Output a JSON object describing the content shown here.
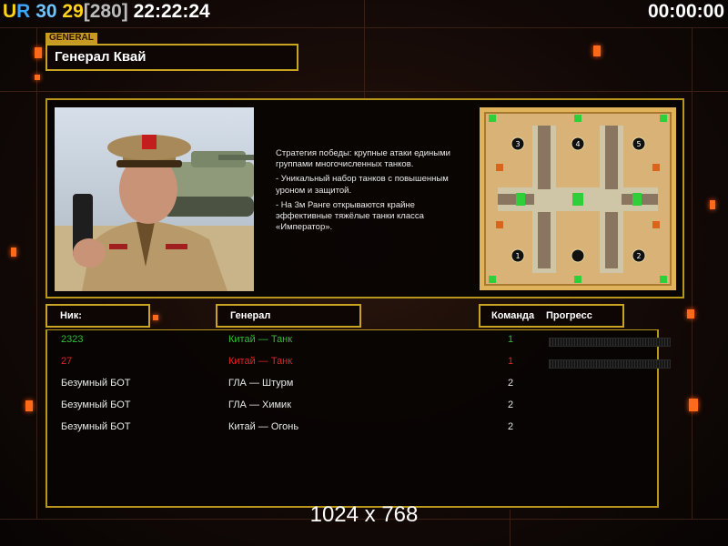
{
  "hud": {
    "ur_u": "U",
    "ur_r": "R",
    "fps_a": "30",
    "fps_b": "29",
    "fps_c": "[280]",
    "clock": "22:22:24",
    "timer": "00:00:00"
  },
  "general": {
    "tag": "GENERAL",
    "name": "Генерал Квай",
    "desc1": "Стратегия победы: крупные атаки едиными группами многочисленных танков.",
    "desc2": "- Уникальный набор танков с повышенным уроном и защитой.",
    "desc3": "- На 3м Ранге открываются крайне эффективные тяжёлые танки класса «Император»."
  },
  "minimap": {
    "spots": [
      "1",
      "2",
      "3",
      "4",
      "5"
    ]
  },
  "table": {
    "col_nick": "Ник:",
    "col_general": "Генерал",
    "col_team": "Команда",
    "col_progress": "Прогресс",
    "rows": [
      {
        "nick": "2323",
        "general": "Китай — Танк",
        "team": "1",
        "color": "#2fbf2f"
      },
      {
        "nick": "27",
        "general": "Китай — Танк",
        "team": "1",
        "color": "#e02424"
      },
      {
        "nick": "Безумный БОТ",
        "general": "ГЛА — Штурм",
        "team": "2",
        "color": "#e8e8e8"
      },
      {
        "nick": "Безумный БОТ",
        "general": "ГЛА — Химик",
        "team": "2",
        "color": "#e8e8e8"
      },
      {
        "nick": "Безумный БОТ",
        "general": "Китай — Огонь",
        "team": "2",
        "color": "#e8e8e8"
      }
    ]
  },
  "resolution": "1024 x 768",
  "colors": {
    "frame": "#b8961c",
    "accent": "#ff6a1a"
  }
}
